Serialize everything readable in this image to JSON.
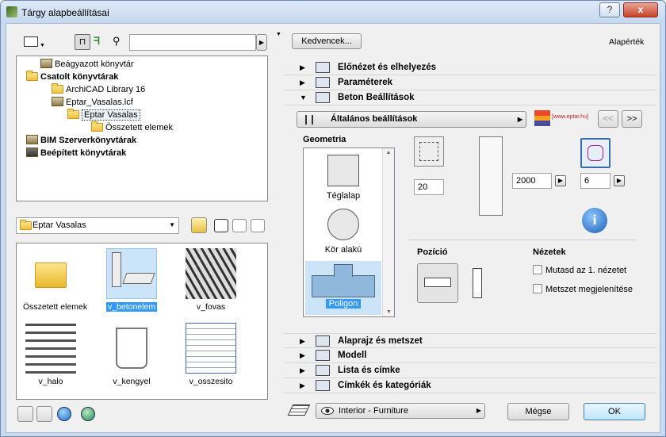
{
  "window": {
    "title": "Tárgy alapbeállításai",
    "help_label": "?",
    "close_label": "x",
    "minimize_label": "▬"
  },
  "left": {
    "search": {
      "placeholder": "",
      "value": ""
    },
    "tree": [
      {
        "label": "Beágyazott könyvtár",
        "bold": false
      },
      {
        "label": "Csatolt könyvtárak",
        "bold": true
      },
      {
        "label": "ArchiCAD Library 16",
        "bold": false
      },
      {
        "label": "Eptar_Vasalas.lcf",
        "bold": false
      },
      {
        "label": "Eptar Vasalas",
        "bold": false
      },
      {
        "label": "Összetett elemek",
        "bold": false
      },
      {
        "label": "BIM Szerverkönyvtárak",
        "bold": true
      },
      {
        "label": "Beépített könyvtárak",
        "bold": true
      }
    ],
    "folder_select": {
      "value": "Eptar Vasalas"
    },
    "thumbs": [
      {
        "label": "Összetett elemek"
      },
      {
        "label": "v_betonelem"
      },
      {
        "label": "v_fovas"
      },
      {
        "label": "v_halo"
      },
      {
        "label": "v_kengyel"
      },
      {
        "label": "v_osszesito"
      }
    ]
  },
  "right": {
    "favorites_label": "Kedvencek...",
    "defaults_label": "Alapérték",
    "sections_top": [
      {
        "label": "Előnézet és elhelyezés",
        "arrow": "▶"
      },
      {
        "label": "Paraméterek",
        "arrow": "▶"
      },
      {
        "label": "Beton Beállítások",
        "arrow": "▼"
      }
    ],
    "subpanel": {
      "select_label": "Általános beállítások",
      "logo_text": "[www.eptar.hu]",
      "prev_label": "<<",
      "next_label": ">>",
      "geometry_label": "Geometria",
      "shapes": [
        {
          "label": "Téglalap"
        },
        {
          "label": "Kör alakú"
        },
        {
          "label": "Poligon"
        }
      ],
      "cover_value": "20",
      "height_value": "2000",
      "sides_value": "6",
      "info_label": "i",
      "position_label": "Pozíció",
      "views_label": "Nézetek",
      "check_first_view": "Mutasd az 1. nézetet",
      "check_section": "Metszet megjelenítése"
    },
    "sections_bottom": [
      {
        "label": "Alaprajz és metszet",
        "arrow": "▶"
      },
      {
        "label": "Modell",
        "arrow": "▶"
      },
      {
        "label": "Lista és címke",
        "arrow": "▶"
      },
      {
        "label": "Címkék és kategóriák",
        "arrow": "▶"
      }
    ],
    "layer_select": "Interior - Furniture",
    "cancel_label": "Mégse",
    "ok_label": "OK"
  },
  "colors": {
    "accent": "#3399ff",
    "selection": "#cce4f7"
  }
}
